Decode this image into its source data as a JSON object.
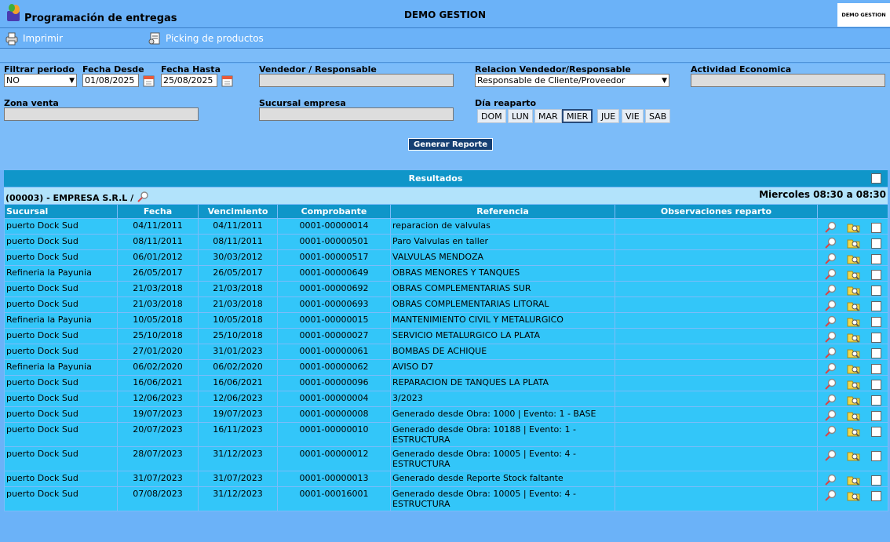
{
  "header": {
    "app_title": "Programación de entregas",
    "company": "DEMO GESTION",
    "brand": "DEMO GESTION"
  },
  "toolbar": {
    "print_label": "Imprimir",
    "picking_label": "Picking de productos"
  },
  "filters": {
    "periodo_label": "Filtrar periodo",
    "periodo_value": "NO",
    "desde_label": "Fecha Desde",
    "desde_value": "01/08/2025",
    "hasta_label": "Fecha Hasta",
    "hasta_value": "25/08/2025",
    "vendedor_label": "Vendedor / Responsable",
    "vendedor_value": "",
    "relacion_label": "Relacion Vendedor/Responsable",
    "relacion_value": "Responsable de Cliente/Proveedor",
    "actividad_label": "Actividad Economica",
    "actividad_value": "",
    "zona_label": "Zona venta",
    "zona_value": "",
    "sucursal_label": "Sucursal empresa",
    "sucursal_value": "",
    "dia_label": "Día reaparto",
    "days": [
      "DOM",
      "LUN",
      "MAR",
      "MIER",
      "JUE",
      "VIE",
      "SAB"
    ],
    "active_day": "MIER",
    "generate_label": "Generar Reporte"
  },
  "results": {
    "title": "Resultados",
    "group_name": "(00003) - EMPRESA S.R.L /",
    "group_schedule": "Miercoles 08:30 a 08:30",
    "columns": [
      "Sucursal",
      "Fecha",
      "Vencimiento",
      "Comprobante",
      "Referencia",
      "Observaciones reparto",
      ""
    ],
    "rows": [
      [
        "puerto Dock Sud",
        "04/11/2011",
        "04/11/2011",
        "0001-00000014",
        "reparacion de valvulas",
        ""
      ],
      [
        "puerto Dock Sud",
        "08/11/2011",
        "08/11/2011",
        "0001-00000501",
        "Paro Valvulas en taller",
        ""
      ],
      [
        "puerto Dock Sud",
        "06/01/2012",
        "30/03/2012",
        "0001-00000517",
        "VALVULAS MENDOZA",
        ""
      ],
      [
        "Refineria la Payunia",
        "26/05/2017",
        "26/05/2017",
        "0001-00000649",
        "OBRAS MENORES Y TANQUES",
        ""
      ],
      [
        "puerto Dock Sud",
        "21/03/2018",
        "21/03/2018",
        "0001-00000692",
        "OBRAS COMPLEMENTARIAS SUR",
        ""
      ],
      [
        "puerto Dock Sud",
        "21/03/2018",
        "21/03/2018",
        "0001-00000693",
        "OBRAS COMPLEMENTARIAS LITORAL",
        ""
      ],
      [
        "Refineria la Payunia",
        "10/05/2018",
        "10/05/2018",
        "0001-00000015",
        "MANTENIMIENTO CIVIL Y METALURGICO",
        ""
      ],
      [
        "puerto Dock Sud",
        "25/10/2018",
        "25/10/2018",
        "0001-00000027",
        "SERVICIO METALURGICO LA PLATA",
        ""
      ],
      [
        "puerto Dock Sud",
        "27/01/2020",
        "31/01/2023",
        "0001-00000061",
        "BOMBAS DE ACHIQUE",
        ""
      ],
      [
        "Refineria la Payunia",
        "06/02/2020",
        "06/02/2020",
        "0001-00000062",
        "AVISO D7",
        ""
      ],
      [
        "puerto Dock Sud",
        "16/06/2021",
        "16/06/2021",
        "0001-00000096",
        "REPARACION DE TANQUES LA PLATA",
        ""
      ],
      [
        "puerto Dock Sud",
        "12/06/2023",
        "12/06/2023",
        "0001-00000004",
        "3/2023",
        ""
      ],
      [
        "puerto Dock Sud",
        "19/07/2023",
        "19/07/2023",
        "0001-00000008",
        "Generado desde Obra: 1000 | Evento: 1 - BASE",
        ""
      ],
      [
        "puerto Dock Sud",
        "20/07/2023",
        "16/11/2023",
        "0001-00000010",
        "Generado desde Obra: 10188 | Evento: 1 - ESTRUCTURA",
        ""
      ],
      [
        "puerto Dock Sud",
        "28/07/2023",
        "31/12/2023",
        "0001-00000012",
        "Generado desde Obra: 10005 | Evento: 4 - ESTRUCTURA",
        ""
      ],
      [
        "puerto Dock Sud",
        "31/07/2023",
        "31/07/2023",
        "0001-00000013",
        "Generado desde Reporte Stock faltante",
        ""
      ],
      [
        "puerto Dock Sud",
        "07/08/2023",
        "31/12/2023",
        "0001-00016001",
        "Generado desde Obra: 10005 | Evento: 4 - ESTRUCTURA",
        ""
      ]
    ]
  },
  "icons": {
    "print": "printer-icon",
    "picking": "picking-icon",
    "calendar": "calendar-icon",
    "view": "magnifier-icon",
    "edit": "folder-search-icon"
  },
  "colors": {
    "background": "#6bb2f8",
    "table_header": "#0f96c9",
    "row_bg": "#33c6f9",
    "group_bg": "#b2e3fb",
    "button": "#153f72"
  }
}
